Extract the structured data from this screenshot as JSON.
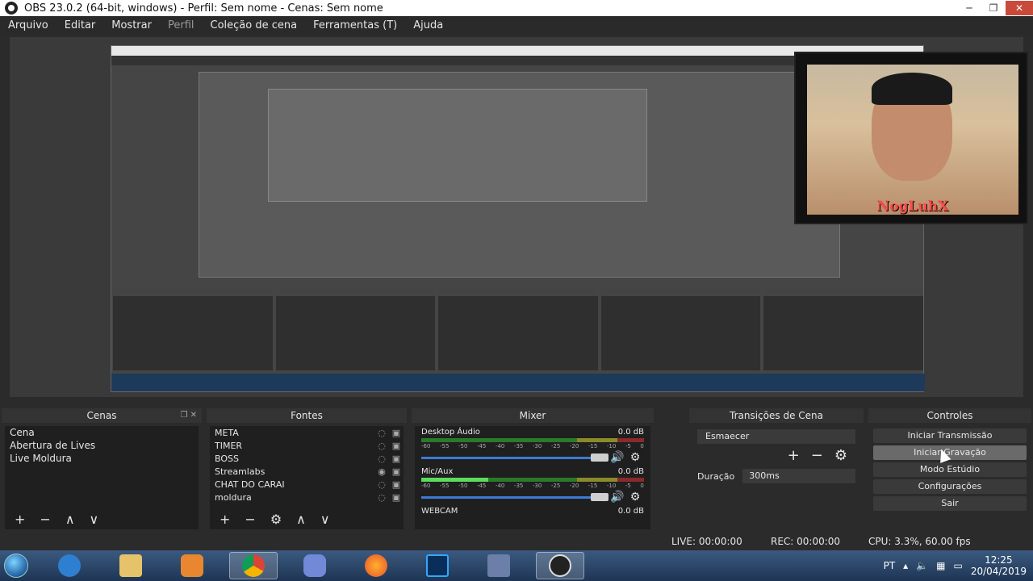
{
  "window": {
    "title": "OBS 23.0.2 (64-bit, windows) - Perfil: Sem nome - Cenas: Sem nome",
    "minimize": "─",
    "maximize": "❐",
    "close": "✕"
  },
  "menu": [
    "Arquivo",
    "Editar",
    "Mostrar",
    "Perfil",
    "Coleção de cena",
    "Ferramentas (T)",
    "Ajuda"
  ],
  "webcam_label": "NogLuhX",
  "docks": {
    "scenes": {
      "title": "Cenas",
      "items": [
        "Cena",
        "Abertura de Lives",
        "Live Moldura"
      ]
    },
    "sources": {
      "title": "Fontes",
      "items": [
        "META",
        "TIMER",
        "BOSS",
        "Streamlabs",
        "CHAT DO CARAI",
        "moldura"
      ]
    },
    "mixer": {
      "title": "Mixer",
      "channels": [
        {
          "name": "Desktop Áudio",
          "level": "0.0 dB"
        },
        {
          "name": "Mic/Aux",
          "level": "0.0 dB"
        },
        {
          "name": "WEBCAM",
          "level": "0.0 dB"
        }
      ],
      "scale": [
        "-60",
        "-55",
        "-50",
        "-45",
        "-40",
        "-35",
        "-30",
        "-25",
        "-20",
        "-15",
        "-10",
        "-5",
        "0"
      ]
    },
    "transitions": {
      "title": "Transições de Cena",
      "selected": "Esmaecer",
      "duration_label": "Duração",
      "duration_value": "300ms"
    },
    "controls": {
      "title": "Controles",
      "buttons": [
        "Iniciar Transmissão",
        "Iniciar Gravação",
        "Modo Estúdio",
        "Configurações",
        "Sair"
      ]
    }
  },
  "status": {
    "live": "LIVE: 00:00:00",
    "rec": "REC: 00:00:00",
    "cpu": "CPU: 3.3%, 60.00 fps"
  },
  "taskbar": {
    "lang": "PT",
    "time": "12:25",
    "date": "20/04/2019",
    "apps": [
      "internet-explorer-icon",
      "file-explorer-icon",
      "media-player-icon",
      "chrome-icon",
      "discord-icon",
      "firefox-icon",
      "photoshop-icon",
      "kf-app-icon",
      "obs-icon"
    ]
  },
  "colors": {
    "accent": "#3c7ad6",
    "webcam_label": "#ff4b4b",
    "taskbar": "#1e3554"
  }
}
